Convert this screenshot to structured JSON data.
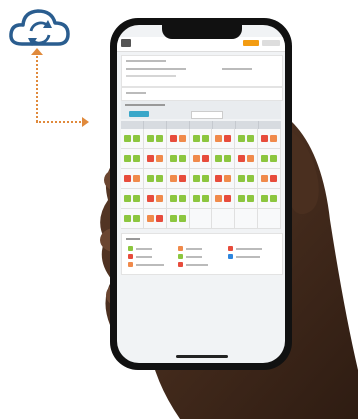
{
  "icons": {
    "cloud": "cloud-sync-icon",
    "connector": "dotted-arrow"
  },
  "colors": {
    "accent": "#2a5d8f",
    "connector": "#e08a3c",
    "present": "#8cc63f",
    "absent": "#e74c3c",
    "late": "#f08a4b",
    "other": "#2e86de"
  },
  "calendar": {
    "days": 7,
    "weeks": 5
  }
}
